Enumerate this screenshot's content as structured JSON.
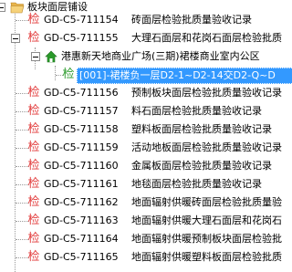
{
  "tree": {
    "root": {
      "label": "板块面层铺设"
    },
    "items_before": [
      {
        "icon": "检",
        "code": "GD-C5-711154",
        "title": "砖面层检验批质量验收记录"
      },
      {
        "icon": "检",
        "code": "GD-C5-711155",
        "title": "大理石面层和花岗石面层检验批质"
      }
    ],
    "project_node": {
      "label": "港惠新天地商业广场(三期)裙楼商业室内公区"
    },
    "selected_record": {
      "icon": "检",
      "label": "[001]-裙楼负一层D2-1~D2-14交D2-Q~D"
    },
    "items_after": [
      {
        "icon": "检",
        "code": "GD-C5-711156",
        "title": "预制板块面层检验批质量验收记录"
      },
      {
        "icon": "检",
        "code": "GD-C5-711157",
        "title": "料石面层检验批质量验收记录"
      },
      {
        "icon": "检",
        "code": "GD-C5-711158",
        "title": "塑料板面层检验批质量验收记录"
      },
      {
        "icon": "检",
        "code": "GD-C5-711159",
        "title": "活动地板面层检验批质量验收记录"
      },
      {
        "icon": "检",
        "code": "GD-C5-711160",
        "title": "金属板面层检验批质量验收记录"
      },
      {
        "icon": "检",
        "code": "GD-C5-711161",
        "title": "地毯面层检验批质量验收记录"
      },
      {
        "icon": "检",
        "code": "GD-C5-711162",
        "title": "地面辐射供暖砖面层检验批质量验"
      },
      {
        "icon": "检",
        "code": "GD-C5-711163",
        "title": "地面辐射供暖大理石面层和花岗石"
      },
      {
        "icon": "检",
        "code": "GD-C5-711164",
        "title": "地面辐射供暖预制板块面层检验批"
      },
      {
        "icon": "检",
        "code": "GD-C5-711165",
        "title": "地面辐射供暖塑料板面层检验批质"
      }
    ]
  },
  "colors": {
    "selection": "#3399ff",
    "record_icon": "#e23a3a",
    "project_icon": "#2a9a2a"
  }
}
